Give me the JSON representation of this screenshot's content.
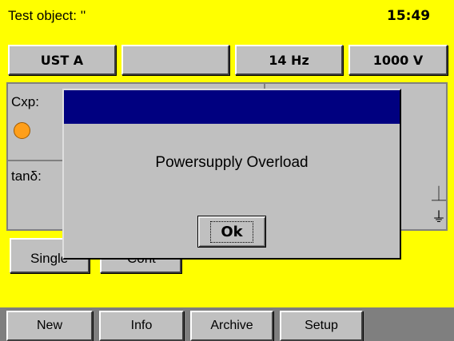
{
  "header": {
    "title": "Test object: ''",
    "clock": "15:49"
  },
  "top_buttons": [
    {
      "label": "UST A"
    },
    {
      "label": ""
    },
    {
      "label": "14 Hz"
    },
    {
      "label": "1000 V"
    }
  ],
  "measurement_panel": {
    "cxp_label": "Cxp:",
    "tand_label": "tanδ:",
    "status_led_color": "#ff9f1a",
    "ground_symbols": [
      "⏊",
      "⏚"
    ]
  },
  "mode_buttons": [
    {
      "label": "Single"
    },
    {
      "label": "Cont"
    }
  ],
  "taskbar": [
    {
      "label": "New"
    },
    {
      "label": "Info"
    },
    {
      "label": "Archive"
    },
    {
      "label": "Setup"
    }
  ],
  "dialog": {
    "message": "Powersupply Overload",
    "ok_label": "Ok"
  },
  "colors": {
    "background": "#ffff00",
    "dialog_title": "#000080",
    "panel": "#c0c0c0"
  }
}
